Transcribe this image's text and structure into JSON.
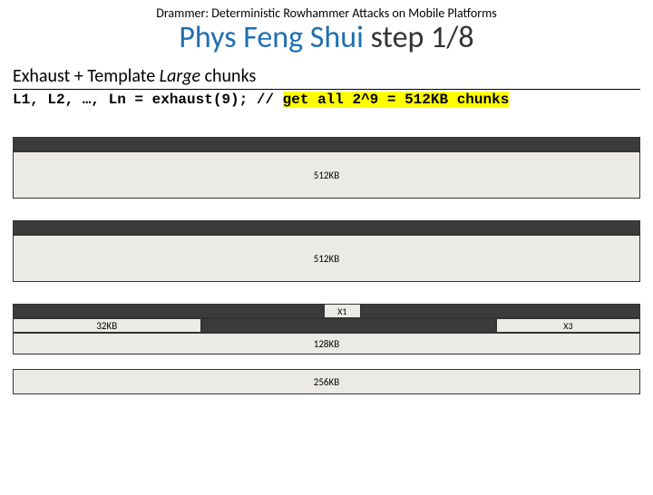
{
  "paper_title": "Drammer: Deterministic Rowhammer Attacks on Mobile Platforms",
  "title_accent": "Phys Feng Shui",
  "title_rest": " step 1/8",
  "subhead_a": "Exhaust + Template ",
  "subhead_italic": "Large",
  "subhead_b": " chunks",
  "code_plain": "L1, L2, …, Ln = exhaust(9); // ",
  "code_hl": "get all 2^9 = 512KB chunks",
  "labels": {
    "chunk512_a": "512KB",
    "chunk512_b": "512KB",
    "x1": "X1",
    "x3": "X3",
    "c32": "32KB",
    "c128": "128KB",
    "c256": "256KB"
  }
}
